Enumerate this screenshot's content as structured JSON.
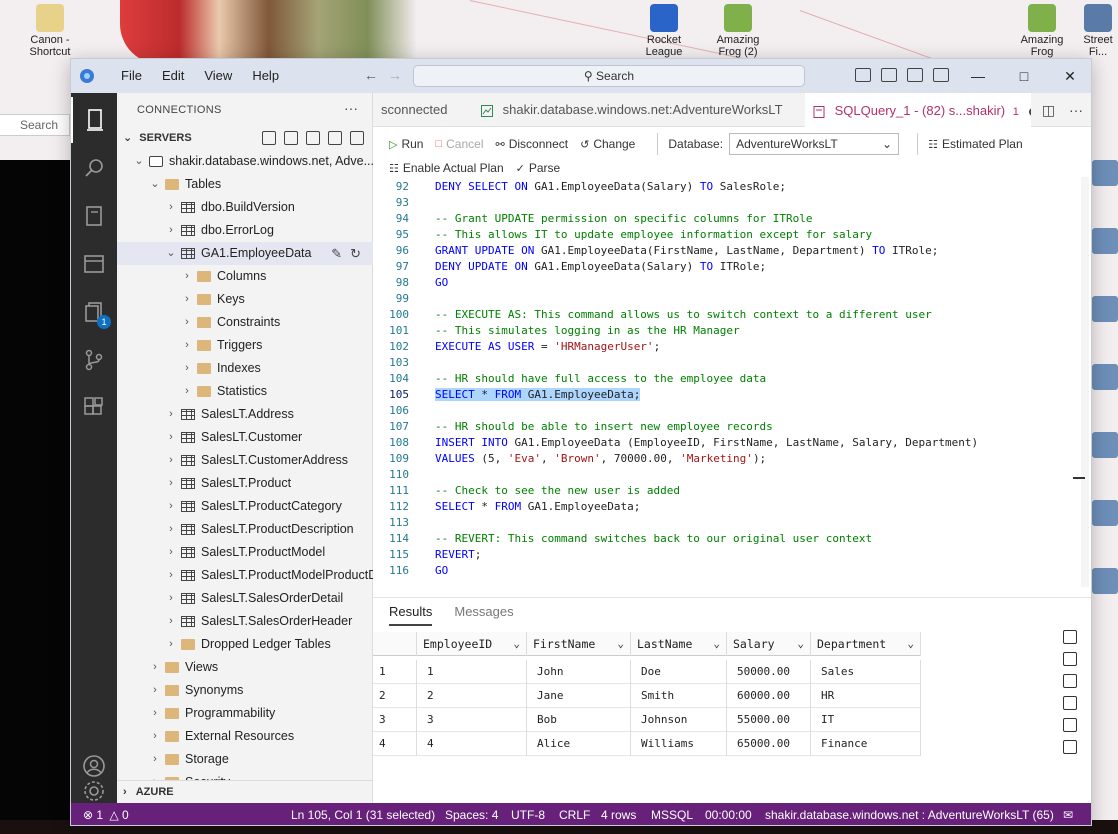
{
  "desktop": {
    "icons_left": [
      {
        "label": "Canon - Shortcut"
      }
    ],
    "icons_top": [
      {
        "label": "Rocket League"
      },
      {
        "label": "Amazing Frog (2)"
      },
      {
        "label": "Amazing Frog"
      },
      {
        "label": "Street Fi..."
      }
    ],
    "peek_search": "Search"
  },
  "titlebar": {
    "menu": [
      "File",
      "Edit",
      "View",
      "Help"
    ],
    "search_placeholder": "Search"
  },
  "activity": {
    "badge_count": "1"
  },
  "sidebar": {
    "header": "CONNECTIONS",
    "servers_label": "SERVERS",
    "azure_label": "AZURE",
    "tree": [
      {
        "indent": 0,
        "twisty": "expanded",
        "icon": "db",
        "label": "shakir.database.windows.net, Adve...",
        "selected": false
      },
      {
        "indent": 1,
        "twisty": "expanded",
        "icon": "folder",
        "label": "Tables",
        "selected": false
      },
      {
        "indent": 2,
        "twisty": "collapsed",
        "icon": "table",
        "label": "dbo.BuildVersion",
        "selected": false
      },
      {
        "indent": 2,
        "twisty": "collapsed",
        "icon": "table",
        "label": "dbo.ErrorLog",
        "selected": false
      },
      {
        "indent": 2,
        "twisty": "expanded",
        "icon": "table",
        "label": "GA1.EmployeeData",
        "selected": true
      },
      {
        "indent": 3,
        "twisty": "collapsed",
        "icon": "folder",
        "label": "Columns",
        "selected": false
      },
      {
        "indent": 3,
        "twisty": "collapsed",
        "icon": "folder",
        "label": "Keys",
        "selected": false
      },
      {
        "indent": 3,
        "twisty": "collapsed",
        "icon": "folder",
        "label": "Constraints",
        "selected": false
      },
      {
        "indent": 3,
        "twisty": "collapsed",
        "icon": "folder",
        "label": "Triggers",
        "selected": false
      },
      {
        "indent": 3,
        "twisty": "collapsed",
        "icon": "folder",
        "label": "Indexes",
        "selected": false
      },
      {
        "indent": 3,
        "twisty": "collapsed",
        "icon": "folder",
        "label": "Statistics",
        "selected": false
      },
      {
        "indent": 2,
        "twisty": "collapsed",
        "icon": "table",
        "label": "SalesLT.Address",
        "selected": false
      },
      {
        "indent": 2,
        "twisty": "collapsed",
        "icon": "table",
        "label": "SalesLT.Customer",
        "selected": false
      },
      {
        "indent": 2,
        "twisty": "collapsed",
        "icon": "table",
        "label": "SalesLT.CustomerAddress",
        "selected": false
      },
      {
        "indent": 2,
        "twisty": "collapsed",
        "icon": "table",
        "label": "SalesLT.Product",
        "selected": false
      },
      {
        "indent": 2,
        "twisty": "collapsed",
        "icon": "table",
        "label": "SalesLT.ProductCategory",
        "selected": false
      },
      {
        "indent": 2,
        "twisty": "collapsed",
        "icon": "table",
        "label": "SalesLT.ProductDescription",
        "selected": false
      },
      {
        "indent": 2,
        "twisty": "collapsed",
        "icon": "table",
        "label": "SalesLT.ProductModel",
        "selected": false
      },
      {
        "indent": 2,
        "twisty": "collapsed",
        "icon": "table",
        "label": "SalesLT.ProductModelProductD...",
        "selected": false
      },
      {
        "indent": 2,
        "twisty": "collapsed",
        "icon": "table",
        "label": "SalesLT.SalesOrderDetail",
        "selected": false
      },
      {
        "indent": 2,
        "twisty": "collapsed",
        "icon": "table",
        "label": "SalesLT.SalesOrderHeader",
        "selected": false
      },
      {
        "indent": 2,
        "twisty": "collapsed",
        "icon": "folder",
        "label": "Dropped Ledger Tables",
        "selected": false
      },
      {
        "indent": 1,
        "twisty": "collapsed",
        "icon": "folder",
        "label": "Views",
        "selected": false
      },
      {
        "indent": 1,
        "twisty": "collapsed",
        "icon": "folder",
        "label": "Synonyms",
        "selected": false
      },
      {
        "indent": 1,
        "twisty": "collapsed",
        "icon": "folder",
        "label": "Programmability",
        "selected": false
      },
      {
        "indent": 1,
        "twisty": "collapsed",
        "icon": "folder",
        "label": "External Resources",
        "selected": false
      },
      {
        "indent": 1,
        "twisty": "collapsed",
        "icon": "folder",
        "label": "Storage",
        "selected": false
      },
      {
        "indent": 1,
        "twisty": "collapsed",
        "icon": "folder",
        "label": "Security",
        "selected": false
      }
    ]
  },
  "tabs": [
    {
      "label": "sconnected",
      "active": false,
      "icon": ""
    },
    {
      "label": "shakir.database.windows.net:AdventureWorksLT",
      "active": false,
      "icon": "chart"
    },
    {
      "label": "SQLQuery_1 - (82) s...shakir)",
      "active": true,
      "icon": "sql",
      "suffix": "1"
    }
  ],
  "toolbar": {
    "run": "Run",
    "cancel": "Cancel",
    "disconnect": "Disconnect",
    "change": "Change",
    "database_label": "Database:",
    "database_value": "AdventureWorksLT",
    "estimated_plan": "Estimated Plan",
    "enable_actual_plan": "Enable Actual Plan",
    "parse": "Parse"
  },
  "editor": {
    "current_line": 105,
    "lines": [
      {
        "n": 92,
        "tokens": [
          [
            "kw",
            "DENY SELECT ON "
          ],
          [
            "tx",
            "GA1.EmployeeData(Salary) "
          ],
          [
            "kw",
            "TO "
          ],
          [
            "tx",
            "SalesRole;"
          ]
        ]
      },
      {
        "n": 93,
        "tokens": []
      },
      {
        "n": 94,
        "tokens": [
          [
            "cm",
            "-- Grant UPDATE permission on specific columns for ITRole"
          ]
        ]
      },
      {
        "n": 95,
        "tokens": [
          [
            "cm",
            "-- This allows IT to update employee information except for salary"
          ]
        ]
      },
      {
        "n": 96,
        "tokens": [
          [
            "kw",
            "GRANT UPDATE ON "
          ],
          [
            "tx",
            "GA1.EmployeeData(FirstName, LastName, Department) "
          ],
          [
            "kw",
            "TO "
          ],
          [
            "tx",
            "ITRole;"
          ]
        ]
      },
      {
        "n": 97,
        "tokens": [
          [
            "kw",
            "DENY UPDATE ON "
          ],
          [
            "tx",
            "GA1.EmployeeData(Salary) "
          ],
          [
            "kw",
            "TO "
          ],
          [
            "tx",
            "ITRole;"
          ]
        ]
      },
      {
        "n": 98,
        "tokens": [
          [
            "kw",
            "GO"
          ]
        ]
      },
      {
        "n": 99,
        "tokens": []
      },
      {
        "n": 100,
        "tokens": [
          [
            "cm",
            "-- EXECUTE AS: This command allows us to switch context to a different user"
          ]
        ]
      },
      {
        "n": 101,
        "tokens": [
          [
            "cm",
            "-- This simulates logging in as the HR Manager"
          ]
        ]
      },
      {
        "n": 102,
        "tokens": [
          [
            "kw",
            "EXECUTE AS USER "
          ],
          [
            "tx",
            "= "
          ],
          [
            "st",
            "'HRManagerUser'"
          ],
          [
            "tx",
            ";"
          ]
        ]
      },
      {
        "n": 103,
        "tokens": []
      },
      {
        "n": 104,
        "tokens": [
          [
            "cm",
            "-- HR should have full access to the employee data"
          ]
        ]
      },
      {
        "n": 105,
        "selected": true,
        "tokens": [
          [
            "kw",
            "SELECT "
          ],
          [
            "tx",
            "* "
          ],
          [
            "kw",
            "FROM "
          ],
          [
            "tx",
            "GA1.EmployeeData;"
          ]
        ]
      },
      {
        "n": 106,
        "tokens": []
      },
      {
        "n": 107,
        "tokens": [
          [
            "cm",
            "-- HR should be able to insert new employee records"
          ]
        ]
      },
      {
        "n": 108,
        "tokens": [
          [
            "kw",
            "INSERT INTO "
          ],
          [
            "tx",
            "GA1.EmployeeData (EmployeeID, FirstName, LastName, Salary, Department)"
          ]
        ]
      },
      {
        "n": 109,
        "tokens": [
          [
            "kw",
            "VALUES "
          ],
          [
            "tx",
            "(5, "
          ],
          [
            "st",
            "'Eva'"
          ],
          [
            "tx",
            ", "
          ],
          [
            "st",
            "'Brown'"
          ],
          [
            "tx",
            ", 70000.00, "
          ],
          [
            "st",
            "'Marketing'"
          ],
          [
            "tx",
            ");"
          ]
        ]
      },
      {
        "n": 110,
        "tokens": []
      },
      {
        "n": 111,
        "tokens": [
          [
            "cm",
            "-- Check to see the new user is added"
          ]
        ]
      },
      {
        "n": 112,
        "tokens": [
          [
            "kw",
            "SELECT "
          ],
          [
            "tx",
            "* "
          ],
          [
            "kw",
            "FROM "
          ],
          [
            "tx",
            "GA1.EmployeeData;"
          ]
        ]
      },
      {
        "n": 113,
        "tokens": []
      },
      {
        "n": 114,
        "tokens": [
          [
            "cm",
            "-- REVERT: This command switches back to our original user context"
          ]
        ]
      },
      {
        "n": 115,
        "tokens": [
          [
            "kw",
            "REVERT"
          ],
          [
            "tx",
            ";"
          ]
        ]
      },
      {
        "n": 116,
        "tokens": [
          [
            "kw",
            "GO"
          ]
        ]
      }
    ]
  },
  "results": {
    "tabs": [
      "Results",
      "Messages"
    ],
    "active_tab": "Results",
    "columns": [
      "EmployeeID",
      "FirstName",
      "LastName",
      "Salary",
      "Department"
    ],
    "rows": [
      {
        "num": "1",
        "cells": [
          "1",
          "John",
          "Doe",
          "50000.00",
          "Sales"
        ]
      },
      {
        "num": "2",
        "cells": [
          "2",
          "Jane",
          "Smith",
          "60000.00",
          "HR"
        ]
      },
      {
        "num": "3",
        "cells": [
          "3",
          "Bob",
          "Johnson",
          "55000.00",
          "IT"
        ]
      },
      {
        "num": "4",
        "cells": [
          "4",
          "Alice",
          "Williams",
          "65000.00",
          "Finance"
        ]
      }
    ]
  },
  "status": {
    "errors": "1",
    "warnings": "0",
    "position": "Ln 105, Col 1 (31 selected)",
    "spaces": "Spaces: 4",
    "encoding": "UTF-8",
    "eol": "CRLF",
    "rows": "4 rows",
    "language": "MSSQL",
    "elapsed": "00:00:00",
    "connection": "shakir.database.windows.net : AdventureWorksLT (65)"
  },
  "colors": {
    "status_bar": "#68217a",
    "activity_bar": "#2c2c2c",
    "keyword": "#0000ff",
    "comment": "#008000",
    "string": "#a31515",
    "selection": "#add6ff",
    "active_tab_text": "#b0306d"
  }
}
